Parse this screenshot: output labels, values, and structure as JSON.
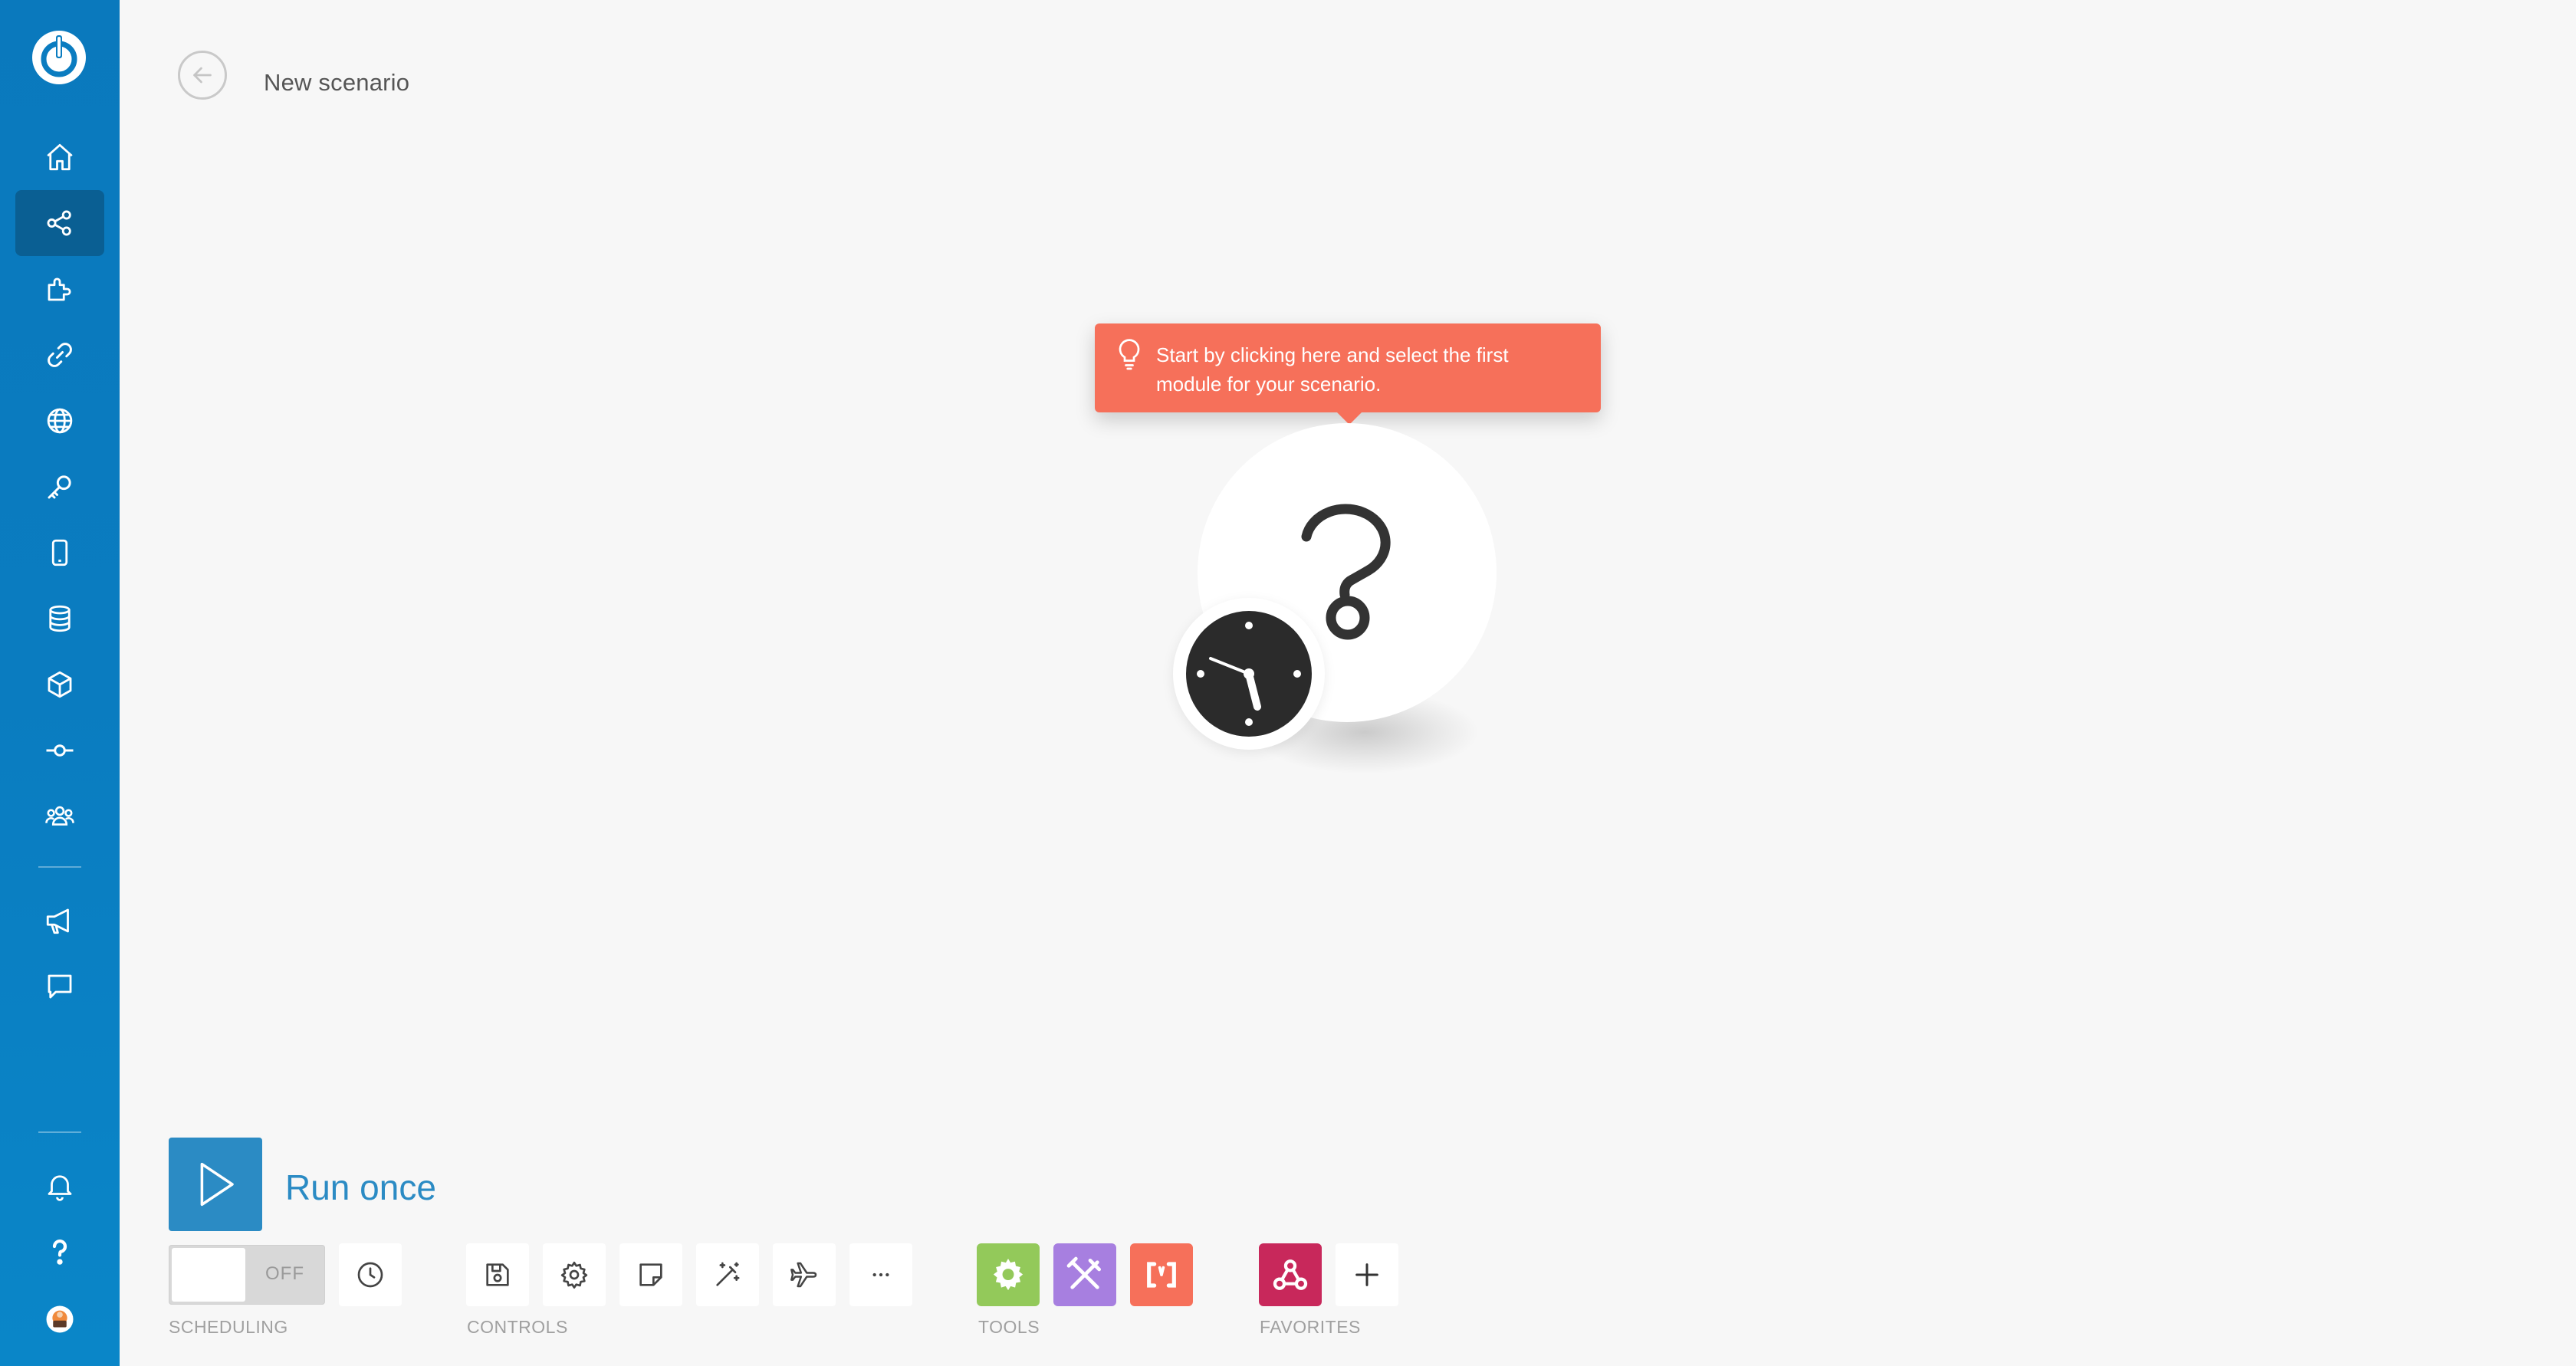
{
  "header": {
    "title": "New scenario"
  },
  "tooltip": {
    "line1": "Start by clicking here and select the first",
    "line2": "module for your scenario."
  },
  "toolbar": {
    "run_label": "Run once",
    "toggle_state": "OFF",
    "sections": {
      "scheduling": "SCHEDULING",
      "controls": "CONTROLS",
      "tools": "TOOLS",
      "favorites": "FAVORITES"
    }
  },
  "colors": {
    "sidebar": "#0a7cc0",
    "sidebar_active": "#0a5f93",
    "tooltip": "#f6705a",
    "run_button": "#2b8bc4",
    "tool_green": "#93c95a",
    "tool_purple": "#a77fe0",
    "tool_orange": "#f6705a",
    "favorite_webhook": "#c8285b"
  },
  "sidebar": {
    "items": [
      {
        "icon": "home-icon"
      },
      {
        "icon": "share-icon"
      },
      {
        "icon": "puzzle-icon"
      },
      {
        "icon": "link-icon"
      },
      {
        "icon": "globe-icon"
      },
      {
        "icon": "key-icon"
      },
      {
        "icon": "phone-icon"
      },
      {
        "icon": "database-icon"
      },
      {
        "icon": "cube-icon"
      },
      {
        "icon": "commit-icon"
      },
      {
        "icon": "team-icon"
      },
      {
        "icon": "megaphone-icon"
      },
      {
        "icon": "chat-icon"
      },
      {
        "icon": "bell-icon"
      },
      {
        "icon": "help-icon"
      },
      {
        "icon": "avatar"
      }
    ]
  }
}
